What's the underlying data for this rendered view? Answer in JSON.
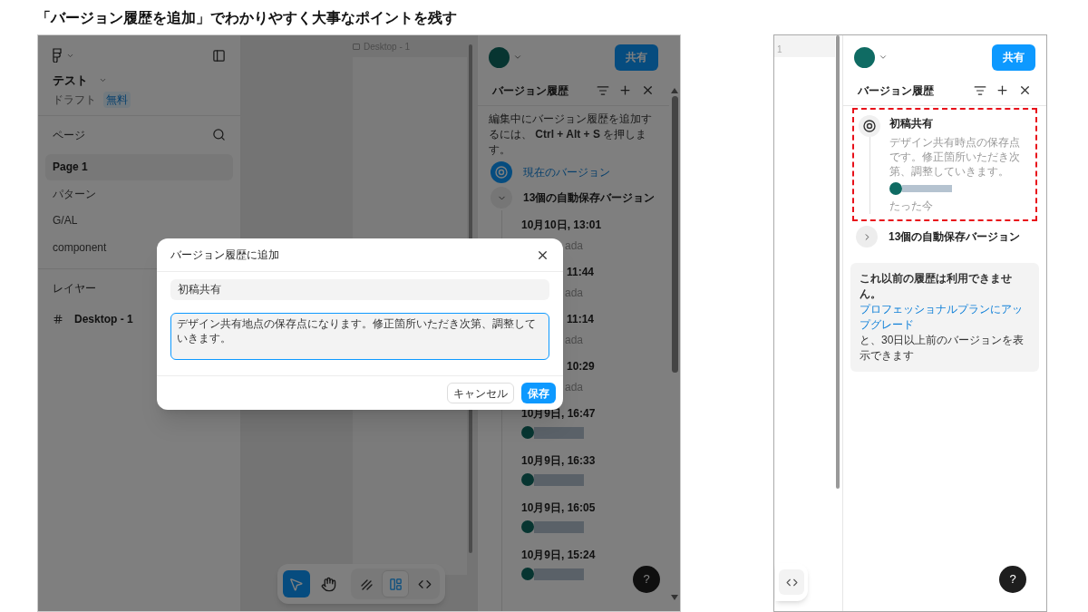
{
  "caption": "「バージョン履歴を追加」でわかりやすく大事なポイントを残す",
  "left_screen": {
    "file": {
      "name": "テスト",
      "status": "ドラフト",
      "plan": "無料"
    },
    "pages_label": "ページ",
    "pages": [
      {
        "label": "Page 1",
        "selected": true
      },
      {
        "label": "パターン",
        "selected": false
      },
      {
        "label": "G/AL",
        "selected": false
      },
      {
        "label": "component",
        "selected": false
      }
    ],
    "layers_label": "レイヤー",
    "layers": [
      {
        "label": "Desktop - 1"
      }
    ],
    "frame_label": "Desktop - 1",
    "tools": [
      {
        "kind": "pointer",
        "selected": true
      },
      {
        "kind": "hand",
        "selected": false
      },
      {
        "kind": "pen",
        "selected": false
      },
      {
        "kind": "frame",
        "selected": true
      },
      {
        "kind": "code",
        "selected": false
      }
    ],
    "share_button": "共有",
    "panel_title": "バージョン履歴",
    "hint": "編集中にバージョン履歴を追加するには、 **Ctrl + Alt + S** を押します。",
    "current_version": "現在のバージョン",
    "autosave": {
      "label": "13個の自動保存バージョン",
      "expanded": true
    },
    "entries": [
      {
        "kind": "named",
        "date": "10月10日, 13:01",
        "date_cut": false,
        "user": "ada"
      },
      {
        "kind": "named",
        "date": "11:44",
        "date_cut": true,
        "user": "ada"
      },
      {
        "kind": "named",
        "date": "11:14",
        "date_cut": true,
        "user": "ada"
      },
      {
        "kind": "named",
        "date": "10:29",
        "date_cut": true,
        "user": "ada"
      },
      {
        "kind": "avatar",
        "date": "10月9日, 16:47"
      },
      {
        "kind": "avatar",
        "date": "10月9日, 16:33"
      },
      {
        "kind": "avatar",
        "date": "10月9日, 16:05"
      },
      {
        "kind": "avatar",
        "date": "10月9日, 15:24"
      }
    ],
    "help": "?",
    "dialog": {
      "title": "バージョン履歴に追加",
      "title_value": "初稿共有",
      "description_value": "デザイン共有地点の保存点になります。修正箇所いただき次第、調整していきます。",
      "cancel": "キャンセル",
      "save": "保存"
    }
  },
  "right_screen": {
    "ruler_mark": "1",
    "share_button": "共有",
    "panel_title": "バージョン履歴",
    "version": {
      "title": "初稿共有",
      "description": "デザイン共有時点の保存点です。修正箇所いただき次第、調整していきます。",
      "time": "たった今"
    },
    "autosave": {
      "label": "13個の自動保存バージョン",
      "expanded": false
    },
    "notice": {
      "heading": "これ以前の履歴は利用できません。",
      "link": "プロフェッショナルプランにアップグレード",
      "rest": "と、30日以上前のバージョンを表示できます"
    },
    "help": "?"
  }
}
